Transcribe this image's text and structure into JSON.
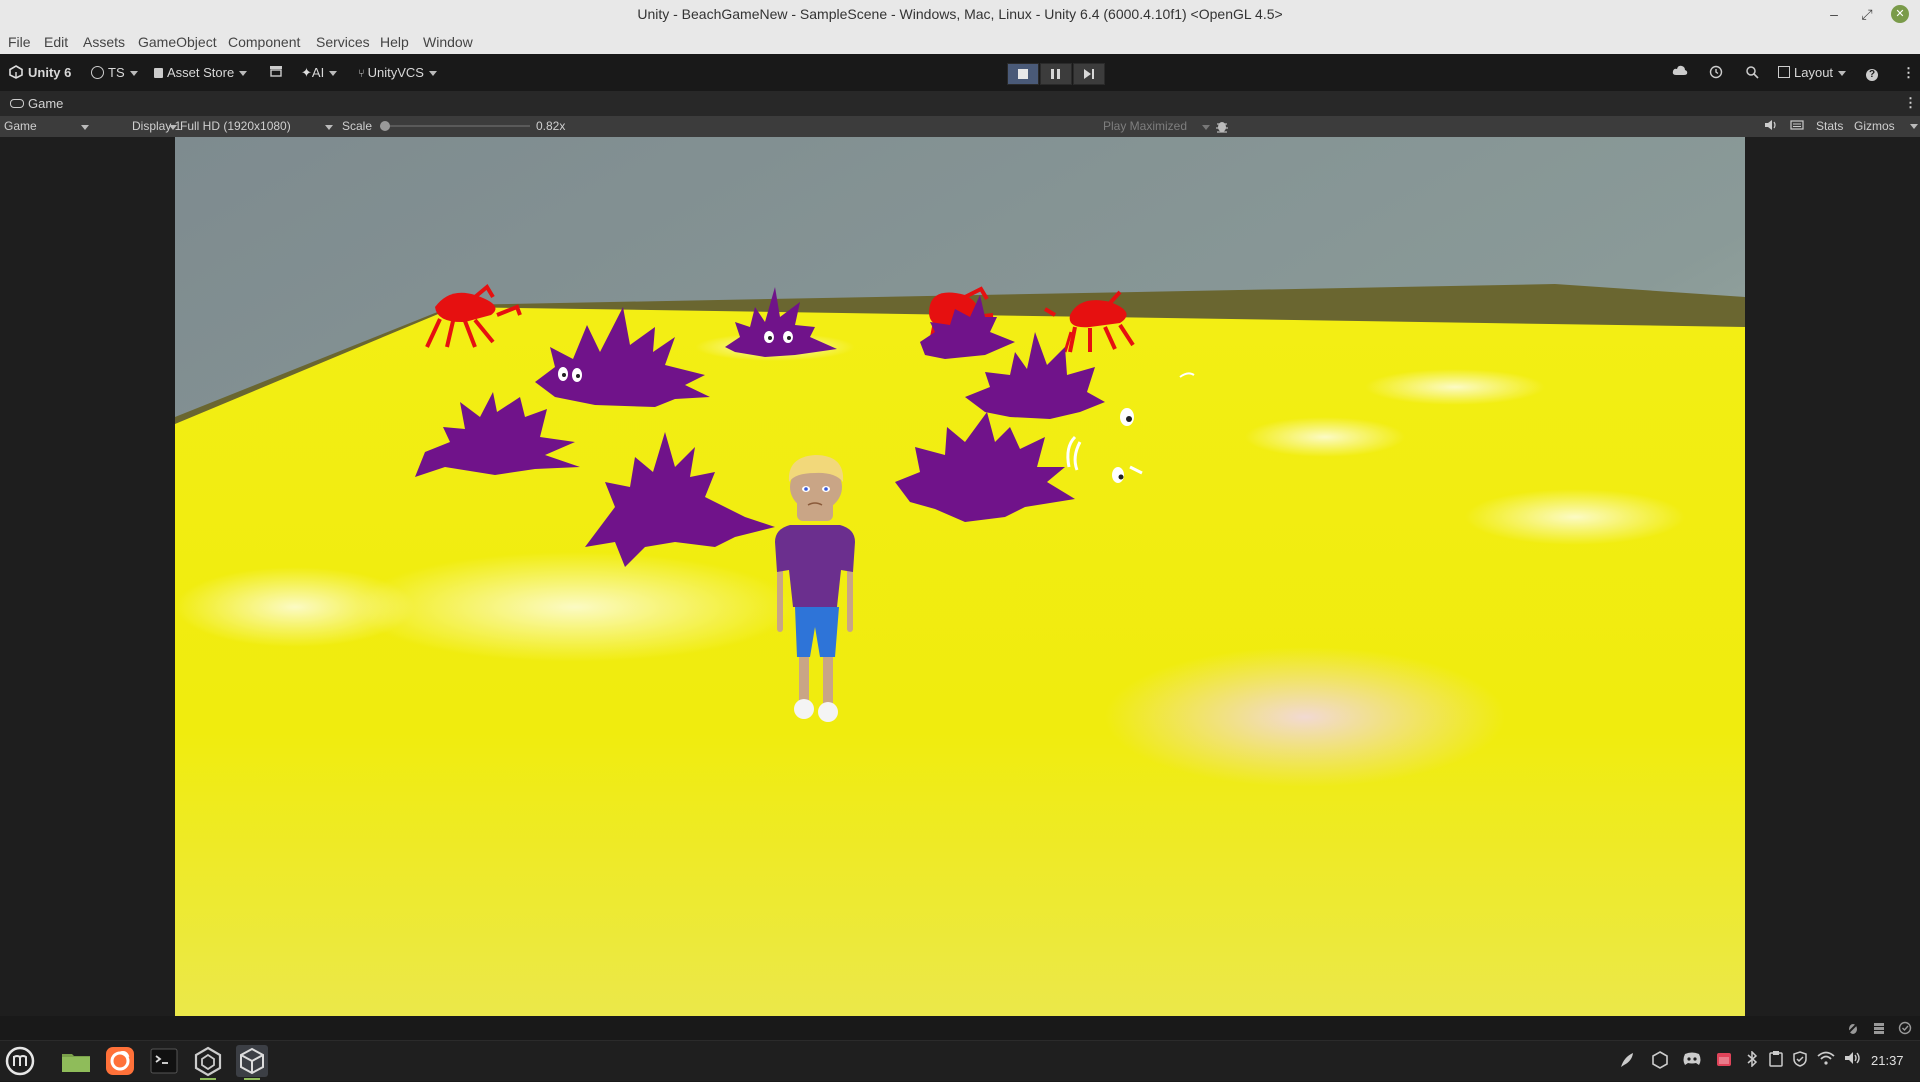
{
  "window": {
    "title": "Unity - BeachGameNew - SampleScene - Windows, Mac, Linux - Unity 6.4 (6000.4.10f1) <OpenGL 4.5>",
    "minimize_glyph": "–",
    "maximize_glyph": "⤢",
    "close_glyph": "✕"
  },
  "menu": [
    "File",
    "Edit",
    "Assets",
    "GameObject",
    "Component",
    "Services",
    "Help",
    "Window"
  ],
  "toolbar": {
    "unity_label": "Unity 6",
    "account_label": "TS",
    "asset_store_label": "Asset Store",
    "ai_label": "AI",
    "vcs_label": "UnityVCS",
    "layout_label": "Layout",
    "play_state": "playing"
  },
  "tab": {
    "label": "Game"
  },
  "game_toolbar": {
    "view_select": "Game",
    "display_select": "Display 1",
    "resolution_select": "Full HD (1920x1080)",
    "scale_label": "Scale",
    "scale_value": "0.82x",
    "scale_fraction": 0.0,
    "play_mode_select": "Play Maximized",
    "stats_label": "Stats",
    "gizmos_label": "Gizmos"
  },
  "taskbar": {
    "clock": "21:37",
    "apps": [
      "menu-icon",
      "files-icon",
      "firefox-icon",
      "terminal-icon",
      "unity-hub-icon",
      "unity-editor-icon"
    ]
  },
  "colors": {
    "sand": "#f4f000",
    "urchin": "#70138a",
    "crab": "#e61010",
    "sky": "#8a9a98",
    "shirt": "#6b2f8e",
    "shorts": "#2e74d8",
    "hair": "#f2d87a"
  }
}
